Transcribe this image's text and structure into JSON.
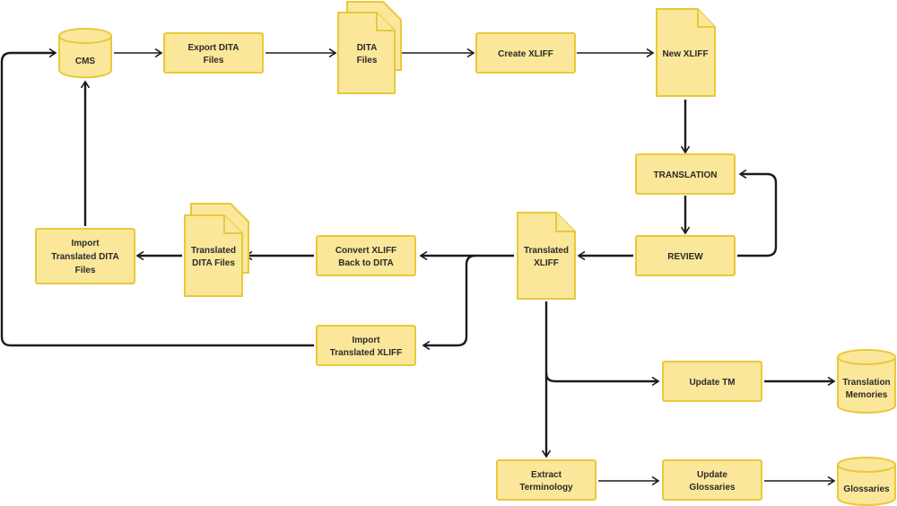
{
  "diagram": {
    "nodes": {
      "cms": {
        "type": "database",
        "lines": [
          "CMS"
        ]
      },
      "export_dita": {
        "type": "process",
        "lines": [
          "Export DITA",
          "Files"
        ]
      },
      "dita_files": {
        "type": "multi-document",
        "lines": [
          "DITA",
          "Files"
        ]
      },
      "create_xliff": {
        "type": "process",
        "lines": [
          "Create XLIFF"
        ]
      },
      "new_xliff": {
        "type": "document",
        "lines": [
          "New XLIFF"
        ]
      },
      "translation": {
        "type": "process",
        "lines": [
          "TRANSLATION"
        ]
      },
      "review": {
        "type": "process",
        "lines": [
          "REVIEW"
        ]
      },
      "translated_xliff": {
        "type": "document",
        "lines": [
          "Translated",
          "XLIFF"
        ]
      },
      "convert_xliff": {
        "type": "process",
        "lines": [
          "Convert XLIFF",
          "Back to DITA"
        ]
      },
      "translated_dita": {
        "type": "multi-document",
        "lines": [
          "Translated",
          "DITA Files"
        ]
      },
      "import_dita": {
        "type": "process",
        "lines": [
          "Import",
          "Translated DITA",
          "Files"
        ]
      },
      "import_xliff": {
        "type": "process",
        "lines": [
          "Import",
          "Translated XLIFF"
        ]
      },
      "update_tm": {
        "type": "process",
        "lines": [
          "Update TM"
        ]
      },
      "tm_db": {
        "type": "database",
        "lines": [
          "Translation",
          "Memories"
        ]
      },
      "extract_term": {
        "type": "process",
        "lines": [
          "Extract",
          "Terminology"
        ]
      },
      "update_gloss": {
        "type": "process",
        "lines": [
          "Update",
          "Glossaries"
        ]
      },
      "gloss_db": {
        "type": "database",
        "lines": [
          "Glossaries"
        ]
      }
    },
    "edges": [
      {
        "from": "cms",
        "to": "export_dita"
      },
      {
        "from": "export_dita",
        "to": "dita_files"
      },
      {
        "from": "dita_files",
        "to": "create_xliff"
      },
      {
        "from": "create_xliff",
        "to": "new_xliff"
      },
      {
        "from": "new_xliff",
        "to": "translation"
      },
      {
        "from": "translation",
        "to": "review"
      },
      {
        "from": "review",
        "to": "translation"
      },
      {
        "from": "review",
        "to": "translated_xliff"
      },
      {
        "from": "translated_xliff",
        "to": "convert_xliff"
      },
      {
        "from": "translated_xliff",
        "to": "import_xliff"
      },
      {
        "from": "convert_xliff",
        "to": "translated_dita"
      },
      {
        "from": "translated_dita",
        "to": "import_dita"
      },
      {
        "from": "import_dita",
        "to": "cms"
      },
      {
        "from": "import_xliff",
        "to": "cms"
      },
      {
        "from": "translated_xliff",
        "to": "update_tm"
      },
      {
        "from": "translated_xliff",
        "to": "extract_term"
      },
      {
        "from": "update_tm",
        "to": "tm_db"
      },
      {
        "from": "extract_term",
        "to": "update_gloss"
      },
      {
        "from": "update_gloss",
        "to": "gloss_db"
      }
    ]
  }
}
